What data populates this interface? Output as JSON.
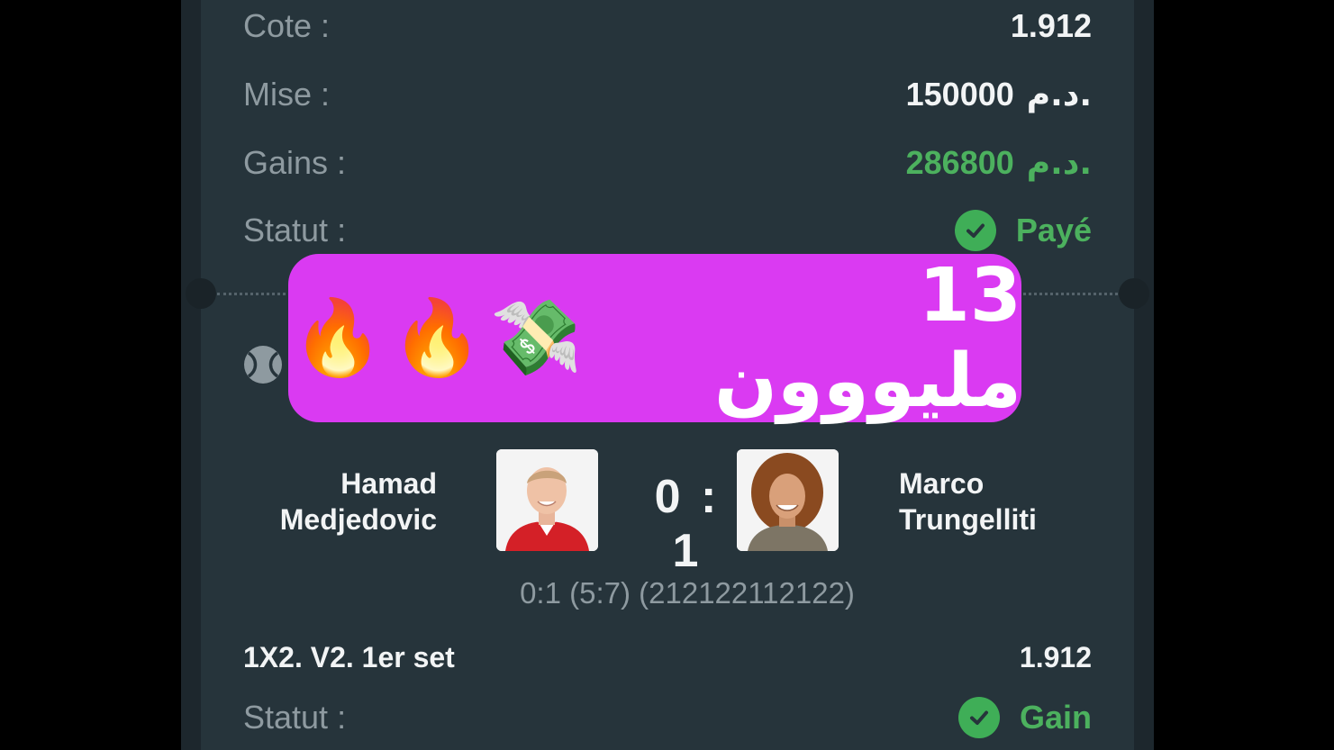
{
  "summary": {
    "cote_label": "Cote :",
    "cote_value": "1.912",
    "mise_label": "Mise :",
    "mise_amount": "150000",
    "mise_currency": "د.م.",
    "gains_label": "Gains :",
    "gains_amount": "286800",
    "gains_currency": "د.م.",
    "statut_label": "Statut :",
    "statut_value": "Payé"
  },
  "overlay": {
    "text": "13 مليووون",
    "emojis": [
      "🔥",
      "🔥",
      "💸"
    ]
  },
  "match": {
    "sport_icon": "tennis-ball-icon",
    "player1_first": "Hamad",
    "player1_last": "Medjedovic",
    "player2_first": "Marco",
    "player2_last": "Trungelliti",
    "score": "0 : 1",
    "score_detail": "0:1 (5:7) (212122112122)"
  },
  "bet": {
    "market": "1X2. V2. 1er set",
    "odds": "1.912",
    "statut_label": "Statut :",
    "statut_value": "Gain"
  },
  "colors": {
    "background": "#26343b",
    "accent_green": "#3fae57",
    "overlay": "#da3af2",
    "muted_text": "#8e9aa0"
  }
}
